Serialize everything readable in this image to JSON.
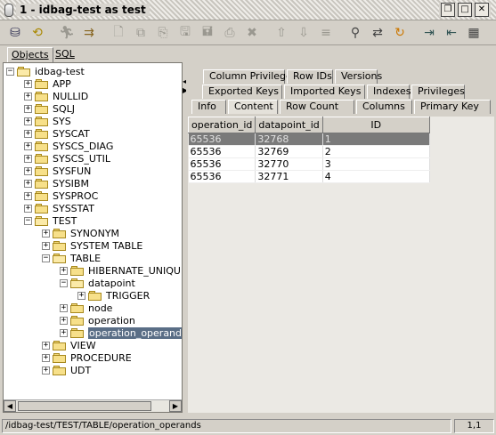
{
  "window": {
    "title": "1 - idbag-test  as test"
  },
  "toolbar": {
    "icons": [
      "connect-icon",
      "reconnect-icon",
      "run-icon",
      "run-all-icon",
      "new-icon",
      "copy-icon",
      "paste-icon",
      "save-icon",
      "save-as-icon",
      "print-icon",
      "cancel-icon",
      "up-icon",
      "down-icon",
      "filter-icon",
      "search-icon",
      "replace-icon",
      "refresh-icon",
      "import-icon",
      "export-icon",
      "columns-icon"
    ]
  },
  "objects_tabs": [
    {
      "label": "Objects"
    },
    {
      "label": "SQL"
    }
  ],
  "tree": [
    {
      "label": "idbag-test",
      "level": 0,
      "exp": "−",
      "open": true,
      "sel": false
    },
    {
      "label": "APP",
      "level": 1,
      "exp": "+",
      "open": false,
      "sel": false
    },
    {
      "label": "NULLID",
      "level": 1,
      "exp": "+",
      "open": false,
      "sel": false
    },
    {
      "label": "SQLJ",
      "level": 1,
      "exp": "+",
      "open": false,
      "sel": false
    },
    {
      "label": "SYS",
      "level": 1,
      "exp": "+",
      "open": false,
      "sel": false
    },
    {
      "label": "SYSCAT",
      "level": 1,
      "exp": "+",
      "open": false,
      "sel": false
    },
    {
      "label": "SYSCS_DIAG",
      "level": 1,
      "exp": "+",
      "open": false,
      "sel": false
    },
    {
      "label": "SYSCS_UTIL",
      "level": 1,
      "exp": "+",
      "open": false,
      "sel": false
    },
    {
      "label": "SYSFUN",
      "level": 1,
      "exp": "+",
      "open": false,
      "sel": false
    },
    {
      "label": "SYSIBM",
      "level": 1,
      "exp": "+",
      "open": false,
      "sel": false
    },
    {
      "label": "SYSPROC",
      "level": 1,
      "exp": "+",
      "open": false,
      "sel": false
    },
    {
      "label": "SYSSTAT",
      "level": 1,
      "exp": "+",
      "open": false,
      "sel": false
    },
    {
      "label": "TEST",
      "level": 1,
      "exp": "−",
      "open": true,
      "sel": false
    },
    {
      "label": "SYNONYM",
      "level": 2,
      "exp": "+",
      "open": false,
      "sel": false
    },
    {
      "label": "SYSTEM TABLE",
      "level": 2,
      "exp": "+",
      "open": false,
      "sel": false
    },
    {
      "label": "TABLE",
      "level": 2,
      "exp": "−",
      "open": true,
      "sel": false
    },
    {
      "label": "HIBERNATE_UNIQUE",
      "level": 3,
      "exp": "+",
      "open": false,
      "sel": false
    },
    {
      "label": "datapoint",
      "level": 3,
      "exp": "−",
      "open": true,
      "sel": false
    },
    {
      "label": "TRIGGER",
      "level": 4,
      "exp": "+",
      "open": false,
      "sel": false
    },
    {
      "label": "node",
      "level": 3,
      "exp": "+",
      "open": false,
      "sel": false
    },
    {
      "label": "operation",
      "level": 3,
      "exp": "+",
      "open": false,
      "sel": false
    },
    {
      "label": "operation_operands",
      "level": 3,
      "exp": "+",
      "open": false,
      "sel": true
    },
    {
      "label": "VIEW",
      "level": 2,
      "exp": "+",
      "open": false,
      "sel": false
    },
    {
      "label": "PROCEDURE",
      "level": 2,
      "exp": "+",
      "open": false,
      "sel": false
    },
    {
      "label": "UDT",
      "level": 2,
      "exp": "+",
      "open": false,
      "sel": false
    }
  ],
  "detail_tabs": {
    "row1": [
      "Column Privileges",
      "Row IDs",
      "Versions"
    ],
    "row2": [
      "Exported Keys",
      "Imported Keys",
      "Indexes",
      "Privileges"
    ],
    "row3": [
      "Info",
      "Content",
      "Row Count",
      "Columns",
      "Primary Key"
    ],
    "active": "Content"
  },
  "grid": {
    "columns": [
      "operation_id",
      "datapoint_id",
      "ID"
    ],
    "rows": [
      [
        "65536",
        "32768",
        "1"
      ],
      [
        "65536",
        "32769",
        "2"
      ],
      [
        "65536",
        "32770",
        "3"
      ],
      [
        "65536",
        "32771",
        "4"
      ]
    ],
    "selected_row": 0
  },
  "status": {
    "path": "/idbag-test/TEST/TABLE/operation_operands",
    "position": "1,1"
  }
}
